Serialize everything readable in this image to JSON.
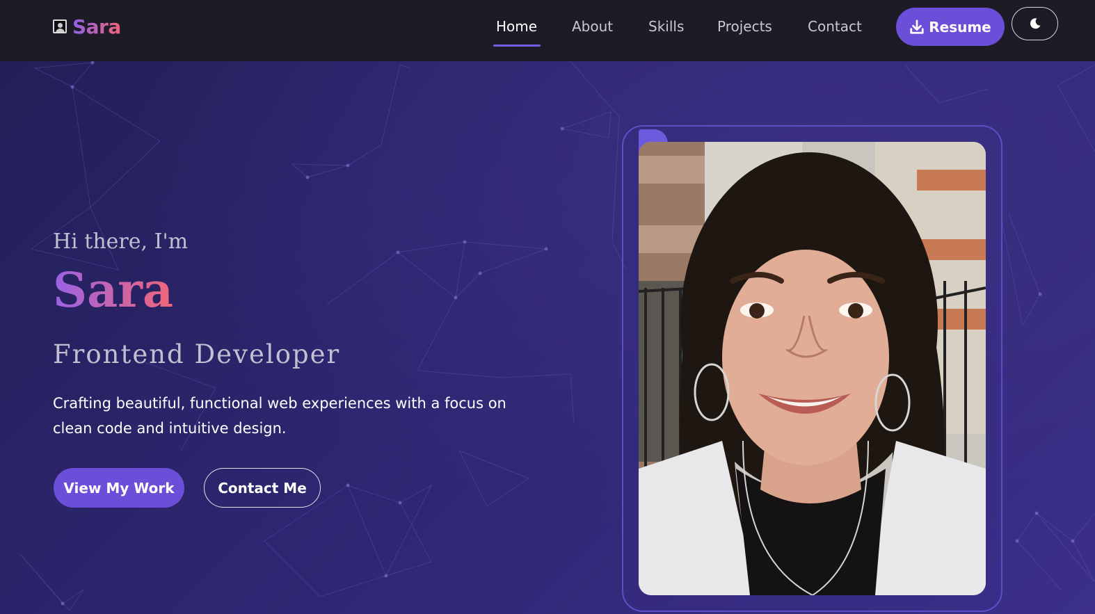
{
  "brand": {
    "name": "Sara",
    "icon": "user-portrait-icon",
    "gradient_start": "#8f62e8",
    "gradient_end": "#f0637a"
  },
  "nav": {
    "links": [
      {
        "label": "Home",
        "active": true
      },
      {
        "label": "About",
        "active": false
      },
      {
        "label": "Skills",
        "active": false
      },
      {
        "label": "Projects",
        "active": false
      },
      {
        "label": "Contact",
        "active": false
      }
    ],
    "resume_label": "Resume",
    "resume_icon": "download-icon",
    "theme_icon": "moon-icon"
  },
  "hero": {
    "greeting": "Hi there, I'm",
    "name": "Sara",
    "role": "Frontend Developer",
    "tagline": "Crafting beautiful, functional web experiences with a focus on clean code and intuitive design.",
    "primary_button": "View My Work",
    "secondary_button": "Contact Me"
  },
  "colors": {
    "accent": "#6c4fd9",
    "nav_background": "#1c1b26",
    "hero_background": "#2a2460"
  }
}
